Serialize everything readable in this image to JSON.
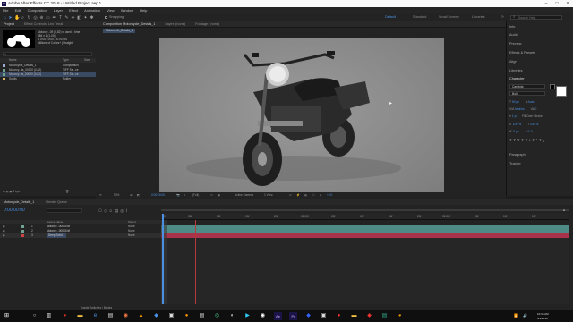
{
  "window": {
    "title": "Adobe After Effects CC 2018 - Untitled Project.aep *"
  },
  "menu": [
    "File",
    "Edit",
    "Composition",
    "Layer",
    "Effect",
    "Animation",
    "View",
    "Window",
    "Help"
  ],
  "toolbar": {
    "snapping_label": "Snapping",
    "workspaces": [
      "Default",
      "Standard",
      "Small Screen",
      "Libraries"
    ],
    "search_placeholder": "Search Help"
  },
  "project": {
    "tabs": [
      "Project",
      "Effect Controls: Leo Tenal"
    ],
    "selected_name": "Motorcy...09 (0,82)",
    "info_lines": [
      "Motorcy...09 (0,82) ▾, used 1 time",
      "384 x 1 (1.00)",
      "Δ 0:00:10:00, 30.00 fps",
      "Millions of Colors+ (Straight)"
    ],
    "columns": [
      "Name",
      "Type",
      "Size"
    ],
    "items": [
      {
        "name": "Motorcycle_Details_1",
        "type": "Composition",
        "color": "#9fa6cf"
      },
      {
        "name": "Motorcy...ta_00000 (0,82)",
        "type": "TIFF Se...ce",
        "color": "#6fa38f"
      },
      {
        "name": "Motorcy...ts_00000 (0,82)",
        "type": "TIFF Se...ce",
        "color": "#6fa38f"
      },
      {
        "name": "Solids",
        "type": "Folder",
        "color": "#d8b766"
      }
    ],
    "footer_bpc": "8 bpc"
  },
  "composition": {
    "tabs": [
      "Composition Motorcycle_Details_1",
      "Layer: (none)",
      "Footage: (none)"
    ],
    "breadcrumb": "Motorcycle_Details_1",
    "footer": {
      "zoom": "50%",
      "time": "0:00:00:00",
      "resolution": "(Full)",
      "camera": "Active Camera",
      "views": "1 View",
      "exposure": "+0.0"
    }
  },
  "right_panel": {
    "items": [
      "Info",
      "Audio",
      "Preview",
      "Effects & Presets",
      "Align",
      "Libraries",
      "Character",
      "Paragraph",
      "Tracker"
    ],
    "character": {
      "font": "Cambria",
      "style": "Bold",
      "size": "50 px",
      "leading": "Auto",
      "kerning": "Metrics",
      "tracking": "0",
      "stroke": "1 px",
      "stroke_type": "Fill Over Stroke",
      "vscale": "100 %",
      "hscale": "100 %",
      "baseline": "0 px",
      "tsume": "0 %"
    },
    "accent": "#4a90e2"
  },
  "timeline": {
    "tabs": [
      "Motorcycle_Details_1",
      "Render Queue"
    ],
    "timecode": "0:00:00:00",
    "columns": [
      "Source Name",
      "Parent"
    ],
    "layers": [
      {
        "num": "1",
        "name": "Motorcy...00000.tif",
        "parent": "None"
      },
      {
        "num": "2",
        "name": "Motorcy...00000.tif",
        "parent": "None"
      },
      {
        "num": "3",
        "name": "Deep Solid 1",
        "parent": "None"
      }
    ],
    "ruler": [
      "0f",
      "05f",
      "10f",
      "15f",
      "20f",
      "01:00f",
      "05f",
      "10f",
      "15f",
      "20f",
      "02:00f",
      "05f",
      "10f",
      "15f"
    ],
    "toggle_label": "Toggle Switches / Modes"
  },
  "taskbar": {
    "time": "10:35 AM",
    "date": "4/3/2018"
  }
}
